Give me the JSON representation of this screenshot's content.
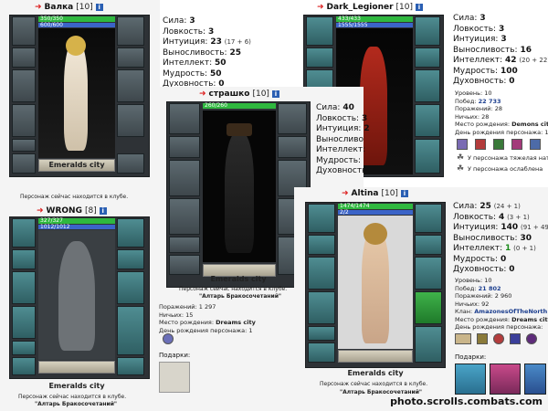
{
  "valka": {
    "name": "Валка",
    "level": "[10]",
    "hp": "350/350",
    "mp": "600/600",
    "stats": [
      {
        "label": "Сила:",
        "value": "3",
        "extra": ""
      },
      {
        "label": "Ловкость:",
        "value": "3",
        "extra": ""
      },
      {
        "label": "Интуиция:",
        "value": "23",
        "extra": "(17 + 6)"
      },
      {
        "label": "Выносливость:",
        "value": "25",
        "extra": ""
      },
      {
        "label": "Интеллект:",
        "value": "50",
        "extra": ""
      },
      {
        "label": "Мудрость:",
        "value": "50",
        "extra": ""
      },
      {
        "label": "Духовность:",
        "value": "0",
        "extra": ""
      }
    ],
    "city": "Emeralds city",
    "status": "Персонаж сейчас находится в клубе."
  },
  "wrong": {
    "name": "WRONG",
    "level": "[8]",
    "hp": "327/327",
    "mp": "1012/1012",
    "city": "Emeralds city",
    "status": "Персонаж сейчас находится в клубе.",
    "location": "\"Алтарь Бракосочетаний\""
  },
  "strashko": {
    "name": "страшко",
    "level": "[10]",
    "hp": "260/260",
    "stats": [
      {
        "label": "Сила:",
        "value": "40"
      },
      {
        "label": "Ловкость:",
        "value": "3"
      },
      {
        "label": "Интуиция:",
        "value": "2"
      },
      {
        "label": "Выносливо",
        "value": ""
      },
      {
        "label": "Интеллект:",
        "value": ""
      },
      {
        "label": "Мудрость:",
        "value": ""
      },
      {
        "label": "Духовность:",
        "value": ""
      }
    ],
    "city": "Emeralds city",
    "status": "Персонаж сейчас находится в клубе.",
    "location": "\"Алтарь Бракосочетаний\"",
    "info": [
      {
        "k": "Поражений:",
        "v": "1 297"
      },
      {
        "k": "Ничьих:",
        "v": "15"
      },
      {
        "k": "Место рождения:",
        "v": "Dreams city"
      },
      {
        "k": "День рождения персонажа:",
        "v": "1"
      }
    ],
    "gifts_label": "Подарки:"
  },
  "dark": {
    "name": "Dark_Legioner",
    "level": "[10]",
    "hp": "433/433",
    "mp": "1555/1555",
    "stats": [
      {
        "label": "Сила:",
        "value": "3",
        "extra": ""
      },
      {
        "label": "Ловкость:",
        "value": "3",
        "extra": ""
      },
      {
        "label": "Интуиция:",
        "value": "3",
        "extra": ""
      },
      {
        "label": "Выносливость:",
        "value": "16",
        "extra": ""
      },
      {
        "label": "Интеллект:",
        "value": "42",
        "extra": "(20 + 22)"
      },
      {
        "label": "Мудрость:",
        "value": "100",
        "extra": ""
      },
      {
        "label": "Духовность:",
        "value": "0",
        "extra": ""
      }
    ],
    "info": [
      {
        "k": "Уровень:",
        "v": "10"
      },
      {
        "k": "Побед:",
        "v": "22 733"
      },
      {
        "k": "Поражений:",
        "v": "28"
      },
      {
        "k": "Ничьих:",
        "v": "28"
      },
      {
        "k": "Место рождения:",
        "v": "Demons city"
      },
      {
        "k": "День рождения персонажа:",
        "v": "1"
      }
    ],
    "effects": [
      "У персонажа тяжелая нат",
      "У персонажа ослаблена"
    ]
  },
  "altina": {
    "name": "Altina",
    "level": "[10]",
    "hp": "1474/1474",
    "mp": "2/2",
    "stats": [
      {
        "label": "Сила:",
        "value": "25",
        "extra": "(24 + 1)"
      },
      {
        "label": "Ловкость:",
        "value": "4",
        "extra": "(3 + 1)"
      },
      {
        "label": "Интуиция:",
        "value": "140",
        "extra": "(91 + 49)"
      },
      {
        "label": "Выносливость:",
        "value": "30",
        "extra": ""
      },
      {
        "label": "Интеллект:",
        "value": "1",
        "extra": "(0 + 1)"
      },
      {
        "label": "Мудрость:",
        "value": "0",
        "extra": ""
      },
      {
        "label": "Духовность:",
        "value": "0",
        "extra": ""
      }
    ],
    "city": "Emeralds city",
    "status": "Персонаж сейчас находится в клубе.",
    "location": "\"Алтарь Бракосочетаний\"",
    "info": [
      {
        "k": "Уровень:",
        "v": "10"
      },
      {
        "k": "Побед:",
        "v": "21 802"
      },
      {
        "k": "Поражений:",
        "v": "2 960"
      },
      {
        "k": "Ничьих:",
        "v": "92"
      },
      {
        "k": "Клан:",
        "v": "AmazonesOfTheNorth"
      },
      {
        "k": "Место рождения:",
        "v": "Dreams city"
      },
      {
        "k": "День рождения персонажа:",
        "v": ""
      }
    ],
    "gifts_label": "Подарки:"
  },
  "watermark": "photo.scrolls.combats.com",
  "colors": {
    "hp": "#2fb83f",
    "mp": "#3b64c8",
    "link": "#1d3f8f",
    "panel": "#2e3236"
  }
}
